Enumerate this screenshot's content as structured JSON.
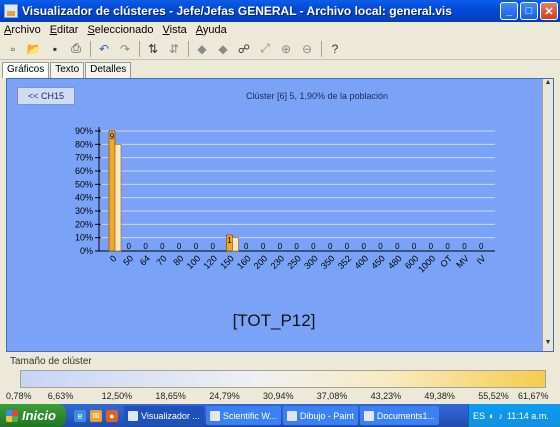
{
  "window": {
    "title": "Visualizador de clústeres - Jefe/Jefas GENERAL - Archivo local: general.vis",
    "minimize": "_",
    "maximize": "□",
    "close": "✕"
  },
  "menu": [
    "Archivo",
    "Editar",
    "Seleccionado",
    "Vista",
    "Ayuda"
  ],
  "toolbar": [
    {
      "icon": "new-icon",
      "glyph": "▫"
    },
    {
      "icon": "open-icon",
      "glyph": "📂"
    },
    {
      "icon": "save-icon",
      "glyph": "▪"
    },
    {
      "icon": "print-icon",
      "glyph": "⎙"
    },
    {
      "icon": "undo-icon",
      "glyph": "↶"
    },
    {
      "icon": "redo-icon",
      "glyph": "↷"
    },
    {
      "icon": "sort-icon",
      "glyph": "⇅"
    },
    {
      "icon": "filter-icon",
      "glyph": "⇵"
    },
    {
      "icon": "back-arrow-icon",
      "glyph": "◆"
    },
    {
      "icon": "forward-arrow-icon",
      "glyph": "◆"
    },
    {
      "icon": "binoculars-icon",
      "glyph": "☍"
    },
    {
      "icon": "fit-icon",
      "glyph": "⤢"
    },
    {
      "icon": "zoom-in-icon",
      "glyph": "⊕"
    },
    {
      "icon": "zoom-out-icon",
      "glyph": "⊖"
    },
    {
      "icon": "help-icon",
      "glyph": "?"
    }
  ],
  "tabs": [
    "Gráficos",
    "Texto",
    "Detalles"
  ],
  "panel": {
    "back_button": "<< CH15",
    "cluster_title": "Clúster [6] 5, 1,90% de la población",
    "variable_title": "[TOT_P12]"
  },
  "chart_data": {
    "type": "bar",
    "categories": [
      "0",
      "50",
      "64",
      "70",
      "80",
      "100",
      "120",
      "150",
      "160",
      "200",
      "230",
      "250",
      "300",
      "350",
      "352",
      "400",
      "450",
      "480",
      "600",
      "1000",
      "OT",
      "MV",
      "IV"
    ],
    "series": [
      {
        "values": [
          80,
          0,
          0,
          0,
          0,
          0,
          0,
          10,
          0,
          0,
          0,
          0,
          0,
          0,
          0,
          0,
          0,
          0,
          0,
          0,
          0,
          0,
          0
        ]
      },
      {
        "values": [
          90,
          0,
          0,
          0,
          0,
          0,
          0,
          12,
          0,
          0,
          0,
          0,
          0,
          0,
          0,
          0,
          0,
          0,
          0,
          0,
          0,
          0,
          0
        ]
      }
    ],
    "labels": [
      "9",
      "0",
      "0",
      "0",
      "0",
      "0",
      "0",
      "1",
      "0",
      "0",
      "0",
      "0",
      "0",
      "0",
      "0",
      "0",
      "0",
      "0",
      "0",
      "0",
      "0",
      "0",
      "0"
    ],
    "yticks": [
      "0%",
      "10%",
      "20%",
      "30%",
      "40%",
      "50%",
      "60%",
      "70%",
      "80%",
      "90%"
    ],
    "ylim": [
      0,
      90
    ],
    "grid": true,
    "colors": {
      "series": "#f5a623",
      "background": "#7aa3f8"
    }
  },
  "size_section": {
    "label": "Tamaño de clúster",
    "scale": [
      "0,78%",
      "6,63%",
      "12,50%",
      "18,65%",
      "24,79%",
      "30,94%",
      "37,08%",
      "43,23%",
      "49,38%",
      "55,52%",
      "61,67%"
    ]
  },
  "taskbar": {
    "start": "Inicio",
    "tasks": [
      "Visualizador ...",
      "Scientific W...",
      "Dibujo - Paint",
      "Documents1..."
    ],
    "language": "ES",
    "clock": "11:14 a.m."
  }
}
